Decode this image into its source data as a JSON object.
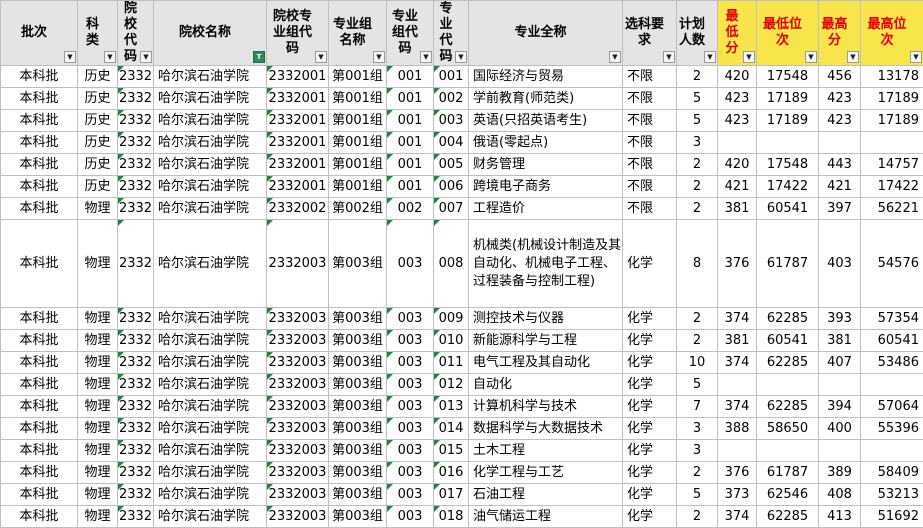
{
  "headers": [
    {
      "label": "批次",
      "red": false
    },
    {
      "label": "科类",
      "red": false
    },
    {
      "label": "院校代码",
      "red": false
    },
    {
      "label": "院校名称",
      "red": false
    },
    {
      "label": "院校专业组代码",
      "red": false
    },
    {
      "label": "专业组名称",
      "red": false
    },
    {
      "label": "专业组代码",
      "red": false
    },
    {
      "label": "专业代码",
      "red": false
    },
    {
      "label": "专业全称",
      "red": false
    },
    {
      "label": "选科要求",
      "red": false
    },
    {
      "label": "计划人数",
      "red": false
    },
    {
      "label": "最低分",
      "red": true
    },
    {
      "label": "最低位次",
      "red": true
    },
    {
      "label": "最高分",
      "red": true
    },
    {
      "label": "最高位次",
      "red": true
    }
  ],
  "filter_icon": "dropdown-arrow-icon",
  "active_filter_icon": "filter-funnel-icon",
  "rows": [
    {
      "batch": "本科批",
      "subject": "历史",
      "code": "2332",
      "name": "哈尔滨石油学院",
      "group_code": "2332001",
      "group_name": "第001组",
      "gcode": "001",
      "major_code": "001",
      "major": "国际经济与贸易",
      "req": "不限",
      "plan": "2",
      "min": "420",
      "min_rank": "17548",
      "max": "456",
      "max_rank": "13178"
    },
    {
      "batch": "本科批",
      "subject": "历史",
      "code": "2332",
      "name": "哈尔滨石油学院",
      "group_code": "2332001",
      "group_name": "第001组",
      "gcode": "001",
      "major_code": "002",
      "major": "学前教育(师范类)",
      "req": "不限",
      "plan": "5",
      "min": "423",
      "min_rank": "17189",
      "max": "423",
      "max_rank": "17189"
    },
    {
      "batch": "本科批",
      "subject": "历史",
      "code": "2332",
      "name": "哈尔滨石油学院",
      "group_code": "2332001",
      "group_name": "第001组",
      "gcode": "001",
      "major_code": "003",
      "major": "英语(只招英语考生)",
      "req": "不限",
      "plan": "5",
      "min": "423",
      "min_rank": "17189",
      "max": "423",
      "max_rank": "17189"
    },
    {
      "batch": "本科批",
      "subject": "历史",
      "code": "2332",
      "name": "哈尔滨石油学院",
      "group_code": "2332001",
      "group_name": "第001组",
      "gcode": "001",
      "major_code": "004",
      "major": "俄语(零起点)",
      "req": "不限",
      "plan": "3",
      "min": "",
      "min_rank": "",
      "max": "",
      "max_rank": ""
    },
    {
      "batch": "本科批",
      "subject": "历史",
      "code": "2332",
      "name": "哈尔滨石油学院",
      "group_code": "2332001",
      "group_name": "第001组",
      "gcode": "001",
      "major_code": "005",
      "major": "财务管理",
      "req": "不限",
      "plan": "2",
      "min": "420",
      "min_rank": "17548",
      "max": "443",
      "max_rank": "14757"
    },
    {
      "batch": "本科批",
      "subject": "历史",
      "code": "2332",
      "name": "哈尔滨石油学院",
      "group_code": "2332001",
      "group_name": "第001组",
      "gcode": "001",
      "major_code": "006",
      "major": "跨境电子商务",
      "req": "不限",
      "plan": "2",
      "min": "421",
      "min_rank": "17422",
      "max": "421",
      "max_rank": "17422"
    },
    {
      "batch": "本科批",
      "subject": "物理",
      "code": "2332",
      "name": "哈尔滨石油学院",
      "group_code": "2332002",
      "group_name": "第002组",
      "gcode": "002",
      "major_code": "007",
      "major": "工程造价",
      "req": "不限",
      "plan": "2",
      "min": "381",
      "min_rank": "60541",
      "max": "397",
      "max_rank": "56221"
    },
    {
      "batch": "本科批",
      "subject": "物理",
      "code": "2332",
      "name": "哈尔滨石油学院",
      "group_code": "2332003",
      "group_name": "第003组",
      "gcode": "003",
      "major_code": "008",
      "major": "机械类(机械设计制造及其自动化、机械电子工程、过程装备与控制工程)",
      "req": "化学",
      "plan": "8",
      "min": "376",
      "min_rank": "61787",
      "max": "403",
      "max_rank": "54576",
      "tall": true
    },
    {
      "batch": "本科批",
      "subject": "物理",
      "code": "2332",
      "name": "哈尔滨石油学院",
      "group_code": "2332003",
      "group_name": "第003组",
      "gcode": "003",
      "major_code": "009",
      "major": "测控技术与仪器",
      "req": "化学",
      "plan": "2",
      "min": "374",
      "min_rank": "62285",
      "max": "393",
      "max_rank": "57354"
    },
    {
      "batch": "本科批",
      "subject": "物理",
      "code": "2332",
      "name": "哈尔滨石油学院",
      "group_code": "2332003",
      "group_name": "第003组",
      "gcode": "003",
      "major_code": "010",
      "major": "新能源科学与工程",
      "req": "化学",
      "plan": "2",
      "min": "381",
      "min_rank": "60541",
      "max": "381",
      "max_rank": "60541"
    },
    {
      "batch": "本科批",
      "subject": "物理",
      "code": "2332",
      "name": "哈尔滨石油学院",
      "group_code": "2332003",
      "group_name": "第003组",
      "gcode": "003",
      "major_code": "011",
      "major": "电气工程及其自动化",
      "req": "化学",
      "plan": "10",
      "min": "374",
      "min_rank": "62285",
      "max": "407",
      "max_rank": "53486"
    },
    {
      "batch": "本科批",
      "subject": "物理",
      "code": "2332",
      "name": "哈尔滨石油学院",
      "group_code": "2332003",
      "group_name": "第003组",
      "gcode": "003",
      "major_code": "012",
      "major": "自动化",
      "req": "化学",
      "plan": "5",
      "min": "",
      "min_rank": "",
      "max": "",
      "max_rank": ""
    },
    {
      "batch": "本科批",
      "subject": "物理",
      "code": "2332",
      "name": "哈尔滨石油学院",
      "group_code": "2332003",
      "group_name": "第003组",
      "gcode": "003",
      "major_code": "013",
      "major": "计算机科学与技术",
      "req": "化学",
      "plan": "7",
      "min": "374",
      "min_rank": "62285",
      "max": "394",
      "max_rank": "57064"
    },
    {
      "batch": "本科批",
      "subject": "物理",
      "code": "2332",
      "name": "哈尔滨石油学院",
      "group_code": "2332003",
      "group_name": "第003组",
      "gcode": "003",
      "major_code": "014",
      "major": "数据科学与大数据技术",
      "req": "化学",
      "plan": "3",
      "min": "388",
      "min_rank": "58650",
      "max": "400",
      "max_rank": "55396"
    },
    {
      "batch": "本科批",
      "subject": "物理",
      "code": "2332",
      "name": "哈尔滨石油学院",
      "group_code": "2332003",
      "group_name": "第003组",
      "gcode": "003",
      "major_code": "015",
      "major": "土木工程",
      "req": "化学",
      "plan": "3",
      "min": "",
      "min_rank": "",
      "max": "",
      "max_rank": ""
    },
    {
      "batch": "本科批",
      "subject": "物理",
      "code": "2332",
      "name": "哈尔滨石油学院",
      "group_code": "2332003",
      "group_name": "第003组",
      "gcode": "003",
      "major_code": "016",
      "major": "化学工程与工艺",
      "req": "化学",
      "plan": "2",
      "min": "376",
      "min_rank": "61787",
      "max": "389",
      "max_rank": "58409"
    },
    {
      "batch": "本科批",
      "subject": "物理",
      "code": "2332",
      "name": "哈尔滨石油学院",
      "group_code": "2332003",
      "group_name": "第003组",
      "gcode": "003",
      "major_code": "017",
      "major": "石油工程",
      "req": "化学",
      "plan": "5",
      "min": "373",
      "min_rank": "62546",
      "max": "408",
      "max_rank": "53213"
    },
    {
      "batch": "本科批",
      "subject": "物理",
      "code": "2332",
      "name": "哈尔滨石油学院",
      "group_code": "2332003",
      "group_name": "第003组",
      "gcode": "003",
      "major_code": "018",
      "major": "油气储运工程",
      "req": "化学",
      "plan": "2",
      "min": "374",
      "min_rank": "62285",
      "max": "413",
      "max_rank": "51692"
    }
  ]
}
